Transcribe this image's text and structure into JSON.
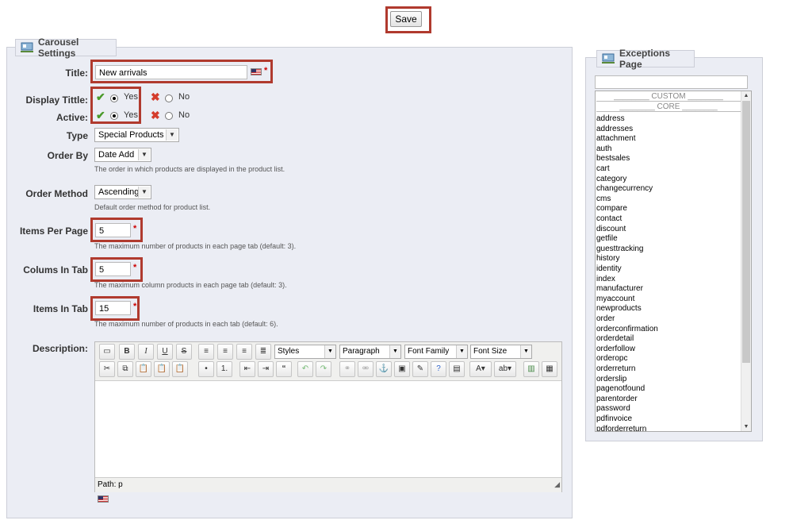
{
  "save_button": "Save",
  "carousel": {
    "legend": "Carousel Settings",
    "title": {
      "label": "Title:",
      "value": "New arrivals",
      "required": "*"
    },
    "display_title": {
      "label": "Display Tittle:",
      "yes": "Yes",
      "no": "No",
      "selected": "Yes"
    },
    "active": {
      "label": "Active:",
      "yes": "Yes",
      "no": "No",
      "selected": "Yes"
    },
    "type": {
      "label": "Type",
      "value": "Special Products"
    },
    "order_by": {
      "label": "Order By",
      "value": "Date Add",
      "help": "The order in which products are displayed in the product list."
    },
    "order_method": {
      "label": "Order Method",
      "value": "Ascending",
      "help": "Default order method for product list."
    },
    "items_per_page": {
      "label": "Items Per Page",
      "value": "5",
      "required": "*",
      "help": "The maximum number of products in each page tab (default: 3)."
    },
    "colums_in_tab": {
      "label": "Colums In Tab",
      "value": "5",
      "required": "*",
      "help": "The maximum column products in each page tab (default: 3)."
    },
    "items_in_tab": {
      "label": "Items In Tab",
      "value": "15",
      "required": "*",
      "help": "The maximum number of products in each tab (default: 6)."
    },
    "description": {
      "label": "Description:",
      "styles": "Styles",
      "format": "Paragraph",
      "font_family": "Font Family",
      "font_size": "Font Size",
      "path": "Path: p"
    }
  },
  "exceptions": {
    "legend": "Exceptions Page",
    "search_value": "",
    "custom_label": "CUSTOM",
    "core_label": "CORE",
    "pages": [
      "address",
      "addresses",
      "attachment",
      "auth",
      "bestsales",
      "cart",
      "category",
      "changecurrency",
      "cms",
      "compare",
      "contact",
      "discount",
      "getfile",
      "guesttracking",
      "history",
      "identity",
      "index",
      "manufacturer",
      "myaccount",
      "newproducts",
      "order",
      "orderconfirmation",
      "orderdetail",
      "orderfollow",
      "orderopc",
      "orderreturn",
      "orderslip",
      "pagenotfound",
      "parentorder",
      "password",
      "pdfinvoice",
      "pdforderreturn"
    ]
  }
}
